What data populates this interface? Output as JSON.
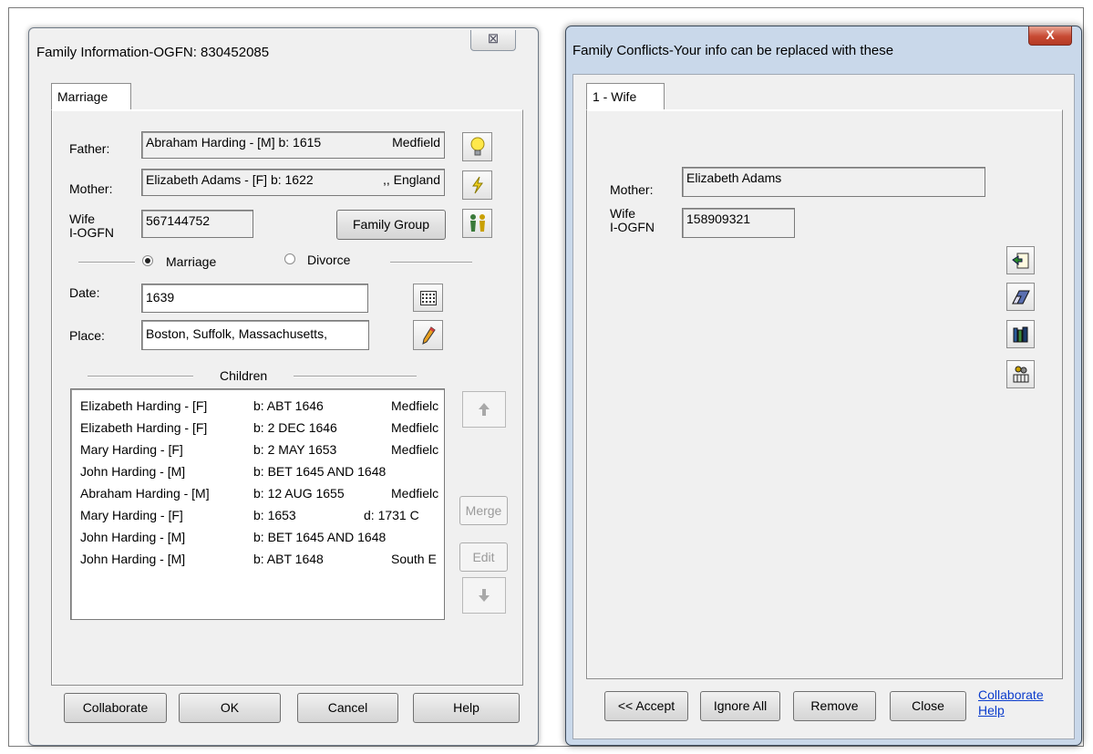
{
  "family_info": {
    "title": "Family Information-OGFN: 830452085",
    "close_label": "⊠",
    "tab": "Marriage",
    "father_label": "Father:",
    "father_value": "Abraham Harding - [M] b: 1615",
    "father_place": "Medfield",
    "mother_label": "Mother:",
    "mother_value": "Elizabeth Adams - [F] b: 1622",
    "mother_place": ",, England",
    "wife_label_1": "Wife",
    "wife_label_2": "I-OGFN",
    "wife_value": "567144752",
    "family_group_button": "Family Group",
    "radio_marriage": "Marriage",
    "radio_divorce": "Divorce",
    "date_label": "Date:",
    "date_value": "1639",
    "place_label": "Place:",
    "place_value": "Boston, Suffolk, Massachusetts,",
    "children_label": "Children",
    "children": [
      {
        "name": "Elizabeth Harding - [F]",
        "birth": "b: ABT 1646",
        "extra": "Medfielc"
      },
      {
        "name": "Elizabeth Harding - [F]",
        "birth": "b: 2 DEC 1646",
        "extra": "Medfielc"
      },
      {
        "name": "Mary Harding - [F]",
        "birth": "b: 2 MAY 1653",
        "extra": "Medfielc"
      },
      {
        "name": "John Harding - [M]",
        "birth": "b: BET 1645 AND 1648",
        "extra": ""
      },
      {
        "name": "Abraham Harding - [M]",
        "birth": "b: 12 AUG 1655",
        "extra": "Medfielc"
      },
      {
        "name": "Mary Harding - [F]",
        "birth": "b: 1653",
        "extra": "d: 1731    C"
      },
      {
        "name": "John Harding - [M]",
        "birth": "b: BET 1645 AND 1648",
        "extra": ""
      },
      {
        "name": "John Harding - [M]",
        "birth": "b: ABT 1648",
        "extra": "South E"
      }
    ],
    "merge_button": "Merge",
    "edit_button": "Edit",
    "collaborate_button": "Collaborate",
    "ok_button": "OK",
    "cancel_button": "Cancel",
    "help_button": "Help"
  },
  "conflicts": {
    "title": "Family Conflicts-Your info can be replaced with these",
    "close_label": "X",
    "tab": "1 - Wife",
    "mother_label": "Mother:",
    "mother_value": "Elizabeth Adams",
    "wife_label_1": "Wife",
    "wife_label_2": "I-OGFN",
    "wife_value": "158909321",
    "accept_button": "<< Accept",
    "ignore_all_button": "Ignore All",
    "remove_button": "Remove",
    "close_button": "Close",
    "collaborate_link": "Collaborate",
    "help_link": "Help"
  },
  "colors": {
    "link": "#0b3ccc",
    "close_red": "#c74a33",
    "dialog_bg": "#f0f0f0"
  }
}
